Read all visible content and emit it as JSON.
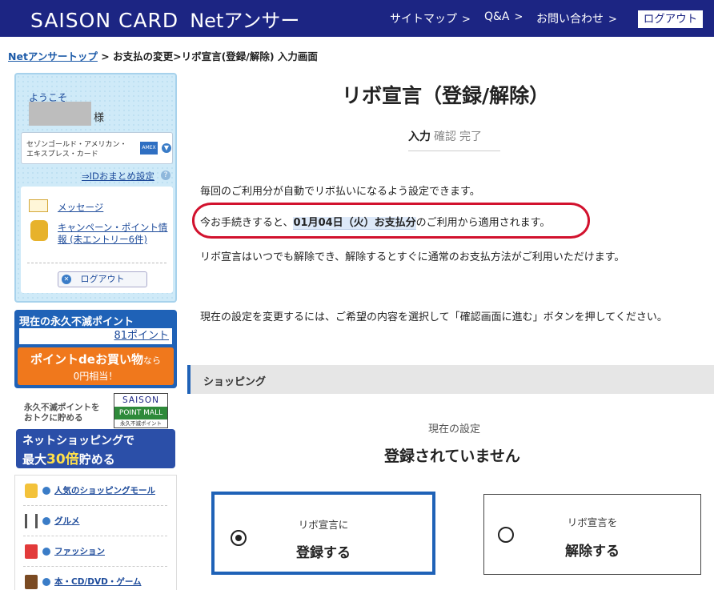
{
  "header": {
    "logo": "SAISON CARD",
    "logo_sub": "Netアンサー",
    "nav": [
      {
        "label": "サイトマップ"
      },
      {
        "label": "Q&A"
      },
      {
        "label": "お問い合わせ"
      }
    ],
    "logout_label": "ログアウト"
  },
  "breadcrumb": {
    "home": "Netアンサートップ",
    "rest": " > お支払の変更>リボ宣言(登録/解除) 入力画面"
  },
  "sidebar": {
    "welcome": "ようこそ",
    "honorific": "様",
    "card_name": "セゾンゴールド・アメリカン・エキスプレス・カード",
    "card_brand": "AMEX",
    "id_link": "⇒IDおまとめ設定",
    "message_link": "メッセージ",
    "campaign_link": "キャンペーン・ポイント情報 (未エントリー6件)",
    "logout_label": "ログアウト",
    "points": {
      "title": "現在の永久不滅ポイント",
      "value": "81ポイント",
      "buy_line1": "ポイントdeお買い物",
      "buy_line1_suffix": "なら",
      "buy_line2": "0円相当！"
    },
    "mall": {
      "text_line1": "永久不滅ポイントを",
      "text_line2": "おトクに貯める",
      "logo_saison": "SAISON",
      "logo_mall": "POINT MALL",
      "logo_footer": "永久不滅ポイント",
      "banner_line1": "ネットショッピングで",
      "banner_line2_pre": "最大",
      "banner_line2_num": "30倍",
      "banner_line2_post": "貯める"
    },
    "categories": [
      {
        "label": "人気のショッピングモール",
        "icon": "shopping-bag-icon"
      },
      {
        "label": "グルメ",
        "icon": "fork-knife-icon"
      },
      {
        "label": "ファッション",
        "icon": "shirt-icon"
      },
      {
        "label": "本・CD/DVD・ゲーム",
        "icon": "book-icon"
      }
    ]
  },
  "main": {
    "title": "リボ宣言（登録/解除）",
    "steps": {
      "current": "入力",
      "others": [
        "確認",
        "完了"
      ]
    },
    "desc1": "毎回のご利用分が自動でリボ払いになるよう設定できます。",
    "desc2_pre": "今お手続きすると、",
    "desc2_date": "01月04日（火）お支払分",
    "desc2_post": "のご利用から適用されます。",
    "desc3": "リボ宣言はいつでも解除でき、解除するとすぐに通常のお支払方法がご利用いただけます。",
    "desc4": "現在の設定を変更するには、ご希望の内容を選択して「確認画面に進む」ボタンを押してください。",
    "section_title": "ショッピング",
    "current_label": "現在の設定",
    "current_value": "登録されていません",
    "options": [
      {
        "line1": "リボ宣言に",
        "line2": "登録する",
        "selected": true
      },
      {
        "line1": "リボ宣言を",
        "line2": "解除する",
        "selected": false
      }
    ]
  },
  "colors": {
    "header_bg": "#1c2583",
    "accent_blue": "#1f62b7",
    "highlight_red": "#d2122e",
    "orange": "#f0781c"
  }
}
